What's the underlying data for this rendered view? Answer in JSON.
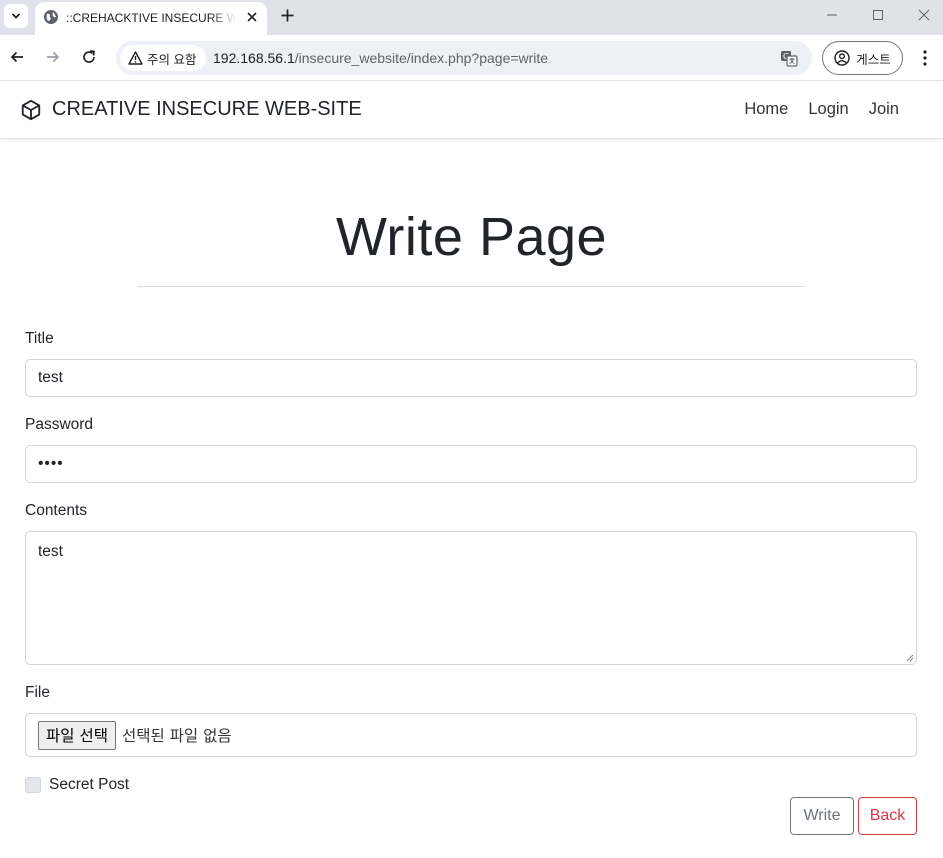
{
  "browser": {
    "tab_title": "::CREHACKTIVE INSECURE WEB-SITE::",
    "security_label": "주의 요함",
    "url_host": "192.168.56.1",
    "url_path": "/insecure_website/index.php?page=write",
    "profile_label": "게스트"
  },
  "site": {
    "brand": "CREATIVE INSECURE WEB-SITE",
    "nav": [
      {
        "label": "Home"
      },
      {
        "label": "Login"
      },
      {
        "label": "Join"
      }
    ]
  },
  "form": {
    "heading": "Write Page",
    "title_label": "Title",
    "title_value": "test",
    "password_label": "Password",
    "password_value": "••••",
    "contents_label": "Contents",
    "contents_value": "test",
    "file_label": "File",
    "file_button": "파일 선택",
    "file_status": "선택된 파일 없음",
    "secret_label": "Secret Post",
    "write_button": "Write",
    "back_button": "Back"
  },
  "colors": {
    "danger": "#dc3545",
    "secondary": "#6c757d",
    "tabbar": "#dfe3e9"
  }
}
